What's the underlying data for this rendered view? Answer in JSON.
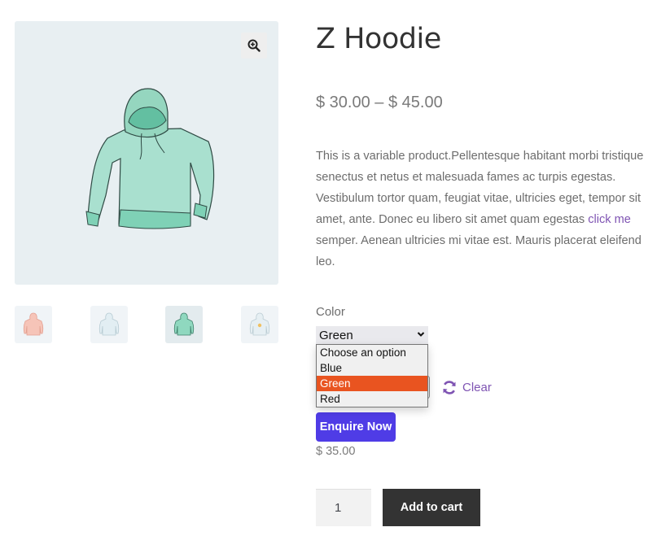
{
  "gallery": {
    "zoom_icon": "magnifier-plus-icon",
    "main_image_alt": "Green hoodie",
    "thumbnails": [
      {
        "color": "pink",
        "fill": "#f6c4b8",
        "stroke": "#e3a091",
        "active": false
      },
      {
        "color": "blue",
        "fill": "#e2eef3",
        "stroke": "#b7cbd3",
        "active": false
      },
      {
        "color": "green",
        "fill": "#8fd8bf",
        "stroke": "#3e7f6a",
        "active": true
      },
      {
        "color": "blue-with-logo",
        "fill": "#e6eff3",
        "stroke": "#bccdd4",
        "active": false
      }
    ]
  },
  "product": {
    "title": "Z Hoodie",
    "price_range": "$ 30.00 – $ 45.00",
    "description_before_link": "This is a variable product.Pellentesque habitant morbi tristique senectus et netus et malesuada fames ac turpis egestas. Vestibulum tortor quam, feugiat vitae, ultricies eget, tempor sit amet, ante. Donec eu libero sit amet quam egestas ",
    "description_link": "click me",
    "description_after_link": " semper. Aenean ultricies mi vitae est. Mauris placerat eleifend leo."
  },
  "variation": {
    "label": "Color",
    "selected": "Green",
    "options": [
      "Choose an option",
      "Blue",
      "Green",
      "Red"
    ],
    "highlighted_index": 2,
    "clear_label": "Clear",
    "clear_icon": "refresh-icon"
  },
  "enquire_label": "Enquire Now",
  "variation_price": "$ 35.00",
  "cart": {
    "quantity": "1",
    "add_label": "Add to cart"
  },
  "colors": {
    "accent_purple": "#7f54b3",
    "enquire_bg": "#4f3ce6",
    "dropdown_highlight": "#e95420",
    "add_cart_bg": "#333333"
  }
}
